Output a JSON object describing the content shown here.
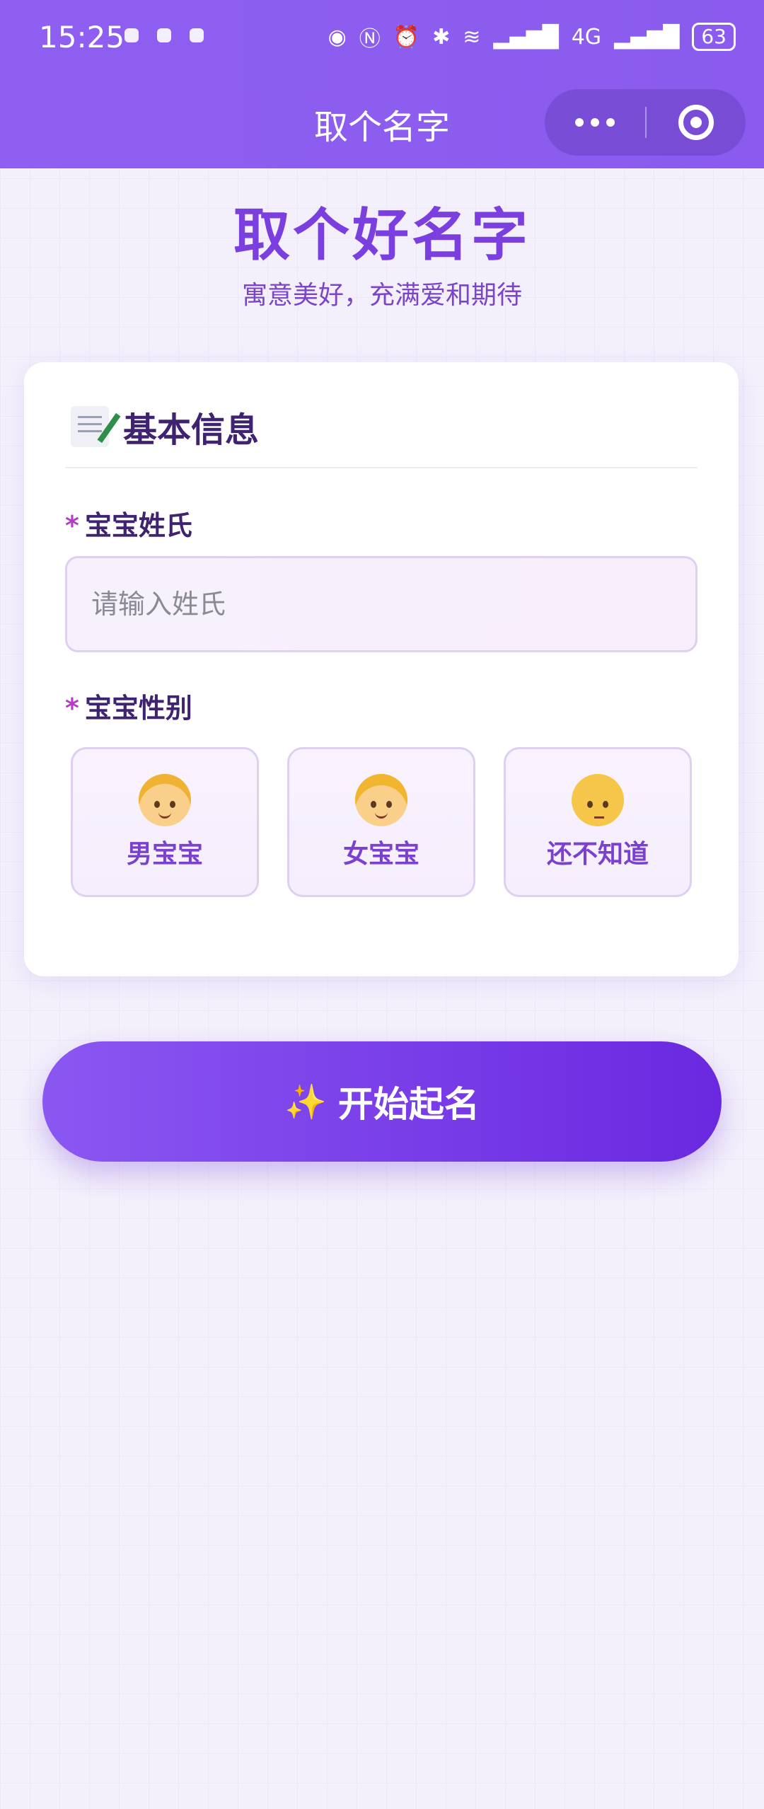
{
  "status_bar": {
    "time": "15:25",
    "network": "4G",
    "battery": "63"
  },
  "nav": {
    "title": "取个名字"
  },
  "hero": {
    "title": "取个好名字",
    "subtitle": "寓意美好，充满爱和期待"
  },
  "card": {
    "title": "基本信息",
    "title_icon": "memo-icon",
    "surname": {
      "required_mark": "*",
      "label": "宝宝姓氏",
      "placeholder": "请输入姓氏",
      "value": ""
    },
    "gender": {
      "required_mark": "*",
      "label": "宝宝性别",
      "options": [
        {
          "label": "男宝宝",
          "icon": "boy-face-icon"
        },
        {
          "label": "女宝宝",
          "icon": "girl-face-icon"
        },
        {
          "label": "还不知道",
          "icon": "thinking-face-icon"
        }
      ]
    }
  },
  "start_button": {
    "label": "开始起名",
    "icon": "sparkles-icon"
  },
  "colors": {
    "primary": "#8e5ff0",
    "accent": "#7b3fe0",
    "text_dark": "#3f2370"
  }
}
